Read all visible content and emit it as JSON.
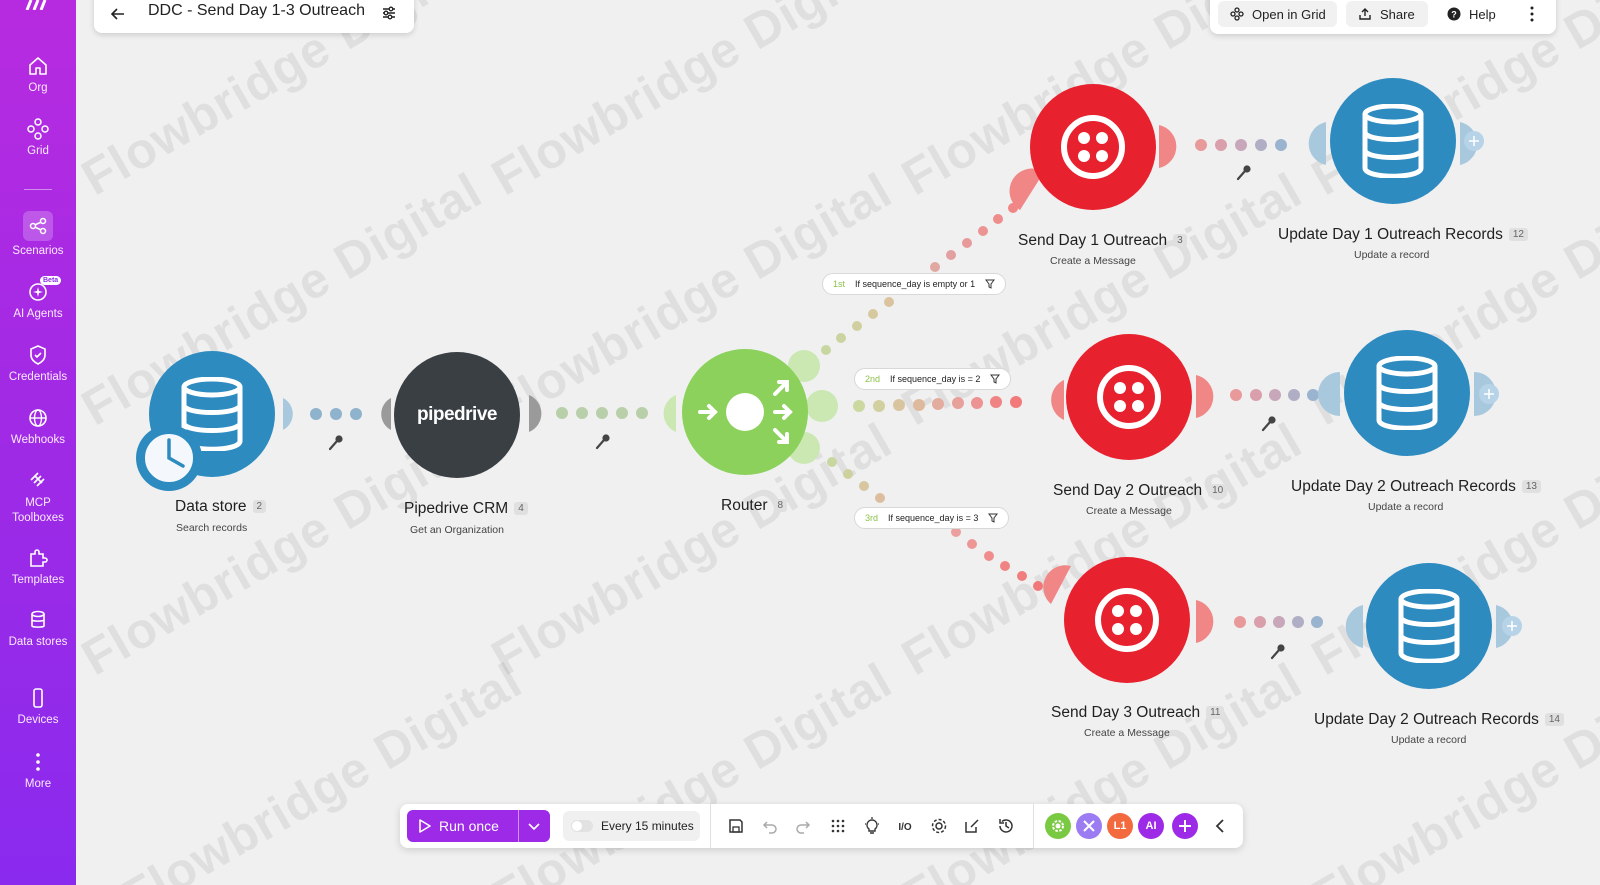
{
  "app": {
    "scenario_title": "DDC - Send Day 1-3 Outreach",
    "watermark": "Flowbridge Digital"
  },
  "sidebar": {
    "items": [
      {
        "label": "Org",
        "icon": "home-icon"
      },
      {
        "label": "Grid",
        "icon": "grid-nodes-icon"
      },
      {
        "label": "Scenarios",
        "icon": "share-nodes-icon",
        "active": true
      },
      {
        "label": "AI Agents",
        "icon": "ai-sparkle-icon",
        "badge": "Beta"
      },
      {
        "label": "Credentials",
        "icon": "shield-icon"
      },
      {
        "label": "Webhooks",
        "icon": "globe-icon"
      },
      {
        "label": "MCP Toolboxes",
        "icon": "mcp-icon"
      },
      {
        "label": "Templates",
        "icon": "puzzle-icon"
      },
      {
        "label": "Data stores",
        "icon": "database-icon"
      },
      {
        "label": "Devices",
        "icon": "phone-icon"
      },
      {
        "label": "More",
        "icon": "more-vertical-icon"
      }
    ]
  },
  "top_right": {
    "open_in_grid": "Open in Grid",
    "share": "Share",
    "help": "Help"
  },
  "nodes": [
    {
      "id": "data-store",
      "title": "Data store",
      "badge": "2",
      "subtitle": "Search records",
      "color": "#2e8bc0"
    },
    {
      "id": "pipedrive",
      "title": "Pipedrive CRM",
      "badge": "4",
      "subtitle": "Get an Organization",
      "logo": "pipedrive",
      "color": "#3a3f44"
    },
    {
      "id": "router",
      "title": "Router",
      "badge": "8",
      "color": "#8bd15b"
    },
    {
      "id": "send-day1",
      "title": "Send Day 1 Outreach",
      "badge": "3",
      "subtitle": "Create a Message",
      "color": "#e8212e"
    },
    {
      "id": "send-day2",
      "title": "Send Day 2 Outreach",
      "badge": "10",
      "subtitle": "Create a Message",
      "color": "#e8212e"
    },
    {
      "id": "send-day3",
      "title": "Send Day 3 Outreach",
      "badge": "11",
      "subtitle": "Create a Message",
      "color": "#e8212e"
    },
    {
      "id": "update-day1",
      "title": "Update Day 1 Outreach Records",
      "badge": "12",
      "subtitle": "Update a record",
      "color": "#2e8bc0"
    },
    {
      "id": "update-day2",
      "title": "Update Day 2 Outreach Records",
      "badge": "13",
      "subtitle": "Update a record",
      "color": "#2e8bc0"
    },
    {
      "id": "update-day3",
      "title": "Update Day 2 Outreach Records",
      "badge": "14",
      "subtitle": "Update a record",
      "color": "#2e8bc0"
    }
  ],
  "filters": [
    {
      "order": "1st",
      "label": "If sequence_day is empty or 1"
    },
    {
      "order": "2nd",
      "label": "If sequence_day is = 2"
    },
    {
      "order": "3rd",
      "label": "If sequence_day is = 3"
    }
  ],
  "toolbar": {
    "run_once": "Run once",
    "schedule": "Every 15 minutes",
    "avatars": [
      {
        "text": "",
        "color": "#7ac943",
        "icon": "gear-icon"
      },
      {
        "text": "",
        "color": "#9b7cf2",
        "icon": "tools-icon"
      },
      {
        "text": "L1",
        "color": "#f26a3d"
      },
      {
        "text": "AI",
        "color": "#9d2ae6"
      }
    ]
  }
}
